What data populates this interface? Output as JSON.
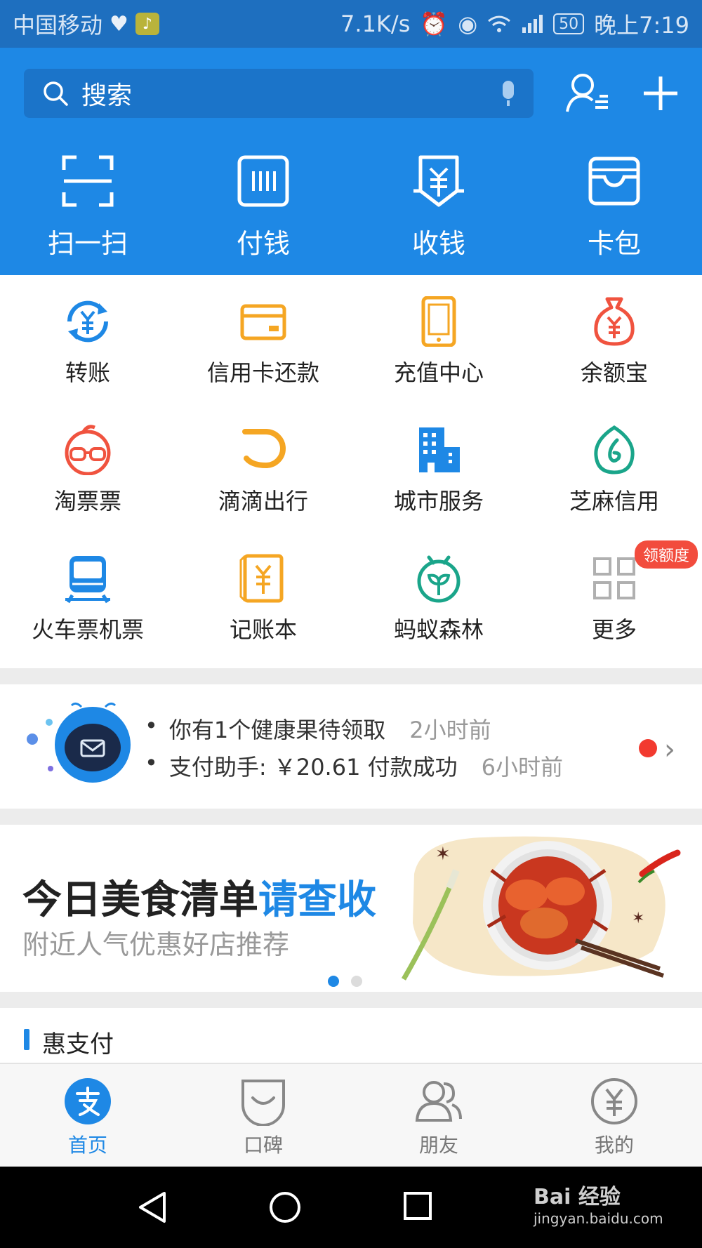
{
  "status_bar": {
    "carrier": "中国移动",
    "speed": "7.1K/s",
    "signal_type": "2G",
    "battery": "50",
    "time": "晚上7:19",
    "icons": [
      "heart-icon",
      "app-icon",
      "alarm-icon",
      "eye-icon",
      "wifi-icon",
      "signal-icon",
      "battery-icon"
    ]
  },
  "header": {
    "search_placeholder": "搜索",
    "quick_actions": [
      {
        "label": "扫一扫",
        "icon": "scan-icon"
      },
      {
        "label": "付钱",
        "icon": "pay-code-icon"
      },
      {
        "label": "收钱",
        "icon": "receive-money-icon"
      },
      {
        "label": "卡包",
        "icon": "card-wallet-icon"
      }
    ]
  },
  "services": [
    {
      "label": "转账",
      "icon": "transfer-icon",
      "color": "#1e88e5"
    },
    {
      "label": "信用卡还款",
      "icon": "credit-card-icon",
      "color": "#f5a623"
    },
    {
      "label": "充值中心",
      "icon": "phone-recharge-icon",
      "color": "#f5a623"
    },
    {
      "label": "余额宝",
      "icon": "money-bag-icon",
      "color": "#f0533f"
    },
    {
      "label": "淘票票",
      "icon": "taopiaopiao-icon",
      "color": "#f0533f"
    },
    {
      "label": "滴滴出行",
      "icon": "didi-icon",
      "color": "#f5a623"
    },
    {
      "label": "城市服务",
      "icon": "city-building-icon",
      "color": "#1e88e5"
    },
    {
      "label": "芝麻信用",
      "icon": "sesame-credit-icon",
      "color": "#1aa58a"
    },
    {
      "label": "火车票机票",
      "icon": "train-icon",
      "color": "#1e88e5"
    },
    {
      "label": "记账本",
      "icon": "ledger-icon",
      "color": "#f5a623"
    },
    {
      "label": "蚂蚁森林",
      "icon": "ant-forest-icon",
      "color": "#1aa58a"
    },
    {
      "label": "更多",
      "icon": "more-grid-icon",
      "color": "#b0b0b0",
      "badge": "领额度"
    }
  ],
  "notifications": [
    {
      "text": "你有1个健康果待领取",
      "time": "2小时前"
    },
    {
      "text": "支付助手: ￥20.61 付款成功",
      "time": "6小时前"
    }
  ],
  "banner": {
    "title_main": "今日美食清单",
    "title_accent": "请查收",
    "subtitle": "附近人气优惠好店推荐",
    "page_count": 2,
    "active_page": 1
  },
  "section": {
    "title": "惠支付"
  },
  "tabbar": [
    {
      "label": "首页",
      "icon": "home-alipay-icon",
      "active": true
    },
    {
      "label": "口碑",
      "icon": "koubei-icon",
      "active": false
    },
    {
      "label": "朋友",
      "icon": "friends-icon",
      "active": false
    },
    {
      "label": "我的",
      "icon": "my-yuan-icon",
      "active": false
    }
  ],
  "watermark": {
    "main": "Bai 经验",
    "sub": "jingyan.baidu.com"
  }
}
